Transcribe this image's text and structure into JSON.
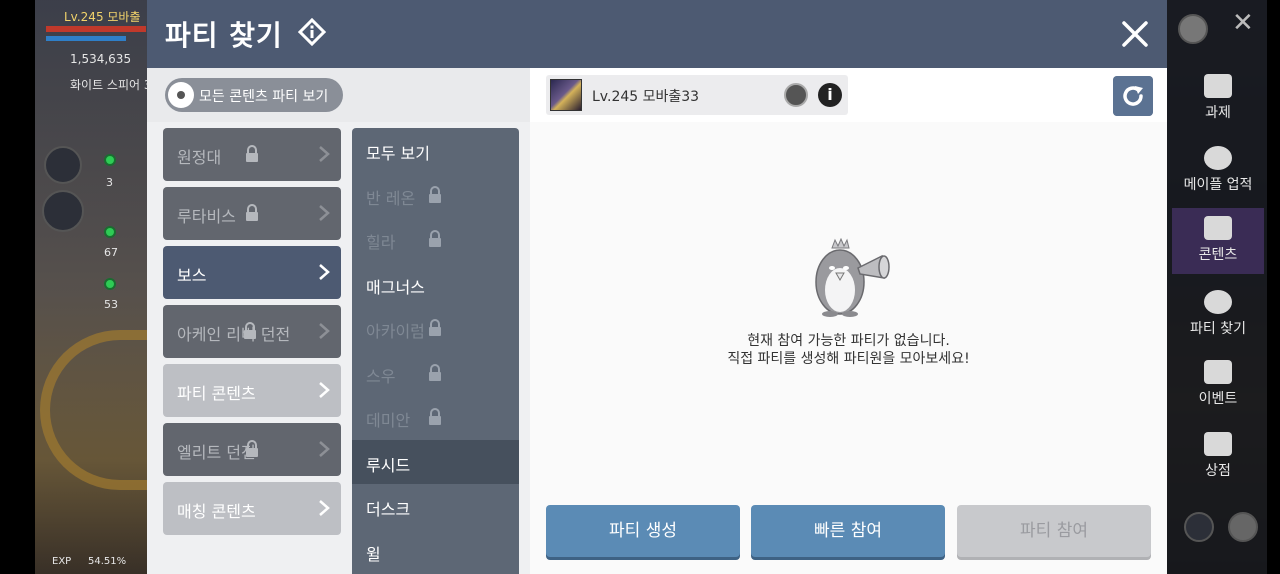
{
  "hud": {
    "level_name": "Lv.245 모바출",
    "meso": "1,534,635",
    "location": "화이트 스피어 3",
    "exp_label": "EXP",
    "exp_value": "54.51%",
    "slot_counts": [
      "3",
      "67",
      "53"
    ]
  },
  "dialog": {
    "title": "파티 찾기",
    "toggle_label": "모든 콘텐츠 파티 보기"
  },
  "categories": [
    {
      "label": "원정대",
      "locked": true,
      "state": "locked"
    },
    {
      "label": "루타비스",
      "locked": true,
      "state": "locked"
    },
    {
      "label": "보스",
      "locked": false,
      "state": "active"
    },
    {
      "label": "아케인 리버 던전",
      "locked": true,
      "state": "locked"
    },
    {
      "label": "파티 콘텐츠",
      "locked": false,
      "state": "open"
    },
    {
      "label": "엘리트 던전",
      "locked": true,
      "state": "locked"
    },
    {
      "label": "매칭 콘텐츠",
      "locked": false,
      "state": "open"
    }
  ],
  "subitems": [
    {
      "label": "모두 보기",
      "locked": false
    },
    {
      "label": "반 레온",
      "locked": true
    },
    {
      "label": "힐라",
      "locked": true
    },
    {
      "label": "매그너스",
      "locked": false
    },
    {
      "label": "아카이럼",
      "locked": true
    },
    {
      "label": "스우",
      "locked": true
    },
    {
      "label": "데미안",
      "locked": true
    },
    {
      "label": "루시드",
      "locked": false,
      "selected": true
    },
    {
      "label": "더스크",
      "locked": false
    },
    {
      "label": "윌",
      "locked": false
    }
  ],
  "character": {
    "name": "Lv.245  모바출33",
    "info_glyph": "i"
  },
  "empty_state": {
    "line1": "현재 참여 가능한 파티가 없습니다.",
    "line2": "직접 파티를 생성해 파티원을 모아보세요!"
  },
  "actions": {
    "create": "파티 생성",
    "quick_join": "빠른 참여",
    "join": "파티 참여"
  },
  "right_menu": [
    {
      "label": "과제",
      "icon": "quest-icon"
    },
    {
      "label": "메이플 업적",
      "icon": "maple-leaf-icon"
    },
    {
      "label": "콘텐츠",
      "icon": "content-icon"
    },
    {
      "label": "파티 찾기",
      "icon": "party-icon"
    },
    {
      "label": "이벤트",
      "icon": "calendar-icon"
    },
    {
      "label": "상점",
      "icon": "cart-icon"
    }
  ],
  "colors": {
    "titlebar": "#4d5a72",
    "accent_button": "#5b8bb5",
    "disabled_button": "#c8c9cc"
  }
}
